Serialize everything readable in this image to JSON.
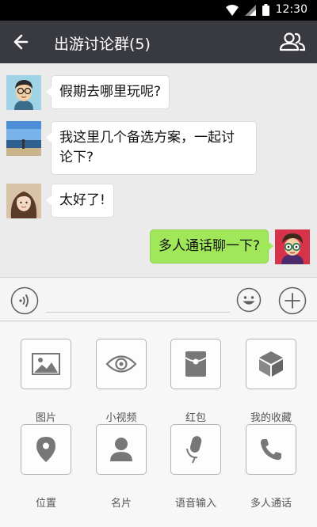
{
  "status": {
    "time": "12:30"
  },
  "header": {
    "title": "出游讨论群(5)",
    "back_icon": "arrow-left-icon",
    "members_icon": "group-members-icon"
  },
  "messages": [
    {
      "sender": "member-1",
      "text": "假期去哪里玩呢?"
    },
    {
      "sender": "member-2",
      "lines": [
        "我这里几个备选方案，一起讨",
        "论下?"
      ]
    },
    {
      "sender": "member-3",
      "text": "太好了!"
    },
    {
      "sender": "me",
      "text": "多人通话聊一下?"
    }
  ],
  "input": {
    "value": "",
    "placeholder": ""
  },
  "panel": {
    "items": [
      {
        "label": "图片",
        "icon": "image-icon"
      },
      {
        "label": "小视频",
        "icon": "eye-icon"
      },
      {
        "label": "红包",
        "icon": "red-packet-icon"
      },
      {
        "label": "我的收藏",
        "icon": "cube-icon"
      },
      {
        "label": "位置",
        "icon": "location-pin-icon"
      },
      {
        "label": "名片",
        "icon": "person-card-icon"
      },
      {
        "label": "语音输入",
        "icon": "microphone-icon"
      },
      {
        "label": "多人通话",
        "icon": "phone-icon"
      }
    ]
  },
  "colors": {
    "titlebar": "#393a3f",
    "my_bubble": "#a0e75a",
    "background": "#ebebeb"
  }
}
